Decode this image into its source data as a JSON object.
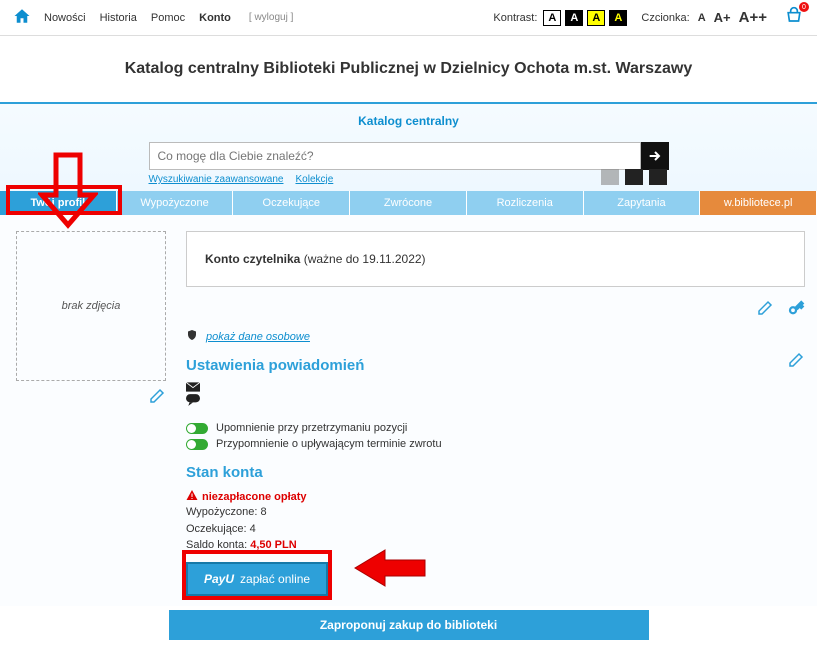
{
  "topnav": {
    "links": [
      "Nowości",
      "Historia",
      "Pomoc",
      "Konto"
    ],
    "logout": "[ wyloguj ]",
    "contrast_label": "Kontrast:",
    "font_label": "Czcionka:",
    "font_sizes": [
      "A",
      "A+",
      "A++"
    ],
    "basket_badge": "0"
  },
  "header_title": "Katalog centralny Biblioteki Publicznej w Dzielnicy Ochota m.st. Warszawy",
  "catalog_label": "Katalog centralny",
  "search": {
    "placeholder": "Co mogę dla Ciebie znaleźć?",
    "adv": "Wyszukiwanie zaawansowane",
    "kolekcje": "Kolekcje"
  },
  "tabs": [
    "Twój profil",
    "Wypożyczone",
    "Oczekujące",
    "Zwrócone",
    "Rozliczenia",
    "Zapytania",
    "w.bibliotece.pl"
  ],
  "photo_placeholder": "brak zdjęcia",
  "account": {
    "label": "Konto czytelnika",
    "valid": " (ważne do 19.11.2022)"
  },
  "personal_link": "pokaż dane osobowe",
  "notif_header": "Ustawienia powiadomień",
  "toggles": [
    "Upomnienie przy przetrzymaniu pozycji",
    "Przypomnienie o upływającym terminie zwrotu"
  ],
  "balance_header": "Stan konta",
  "unpaid": "niezapłacone opłaty",
  "stats": {
    "borrowed_label": "Wypożyczone: ",
    "borrowed_val": "8",
    "pending_label": "Oczekujące: ",
    "pending_val": "4",
    "saldo_label": "Saldo konta: ",
    "saldo_val": "4,50 PLN"
  },
  "pay_btn": "zapłać online",
  "pay_logo": "PayU",
  "bottom_btn": "Zaproponuj zakup do biblioteki"
}
